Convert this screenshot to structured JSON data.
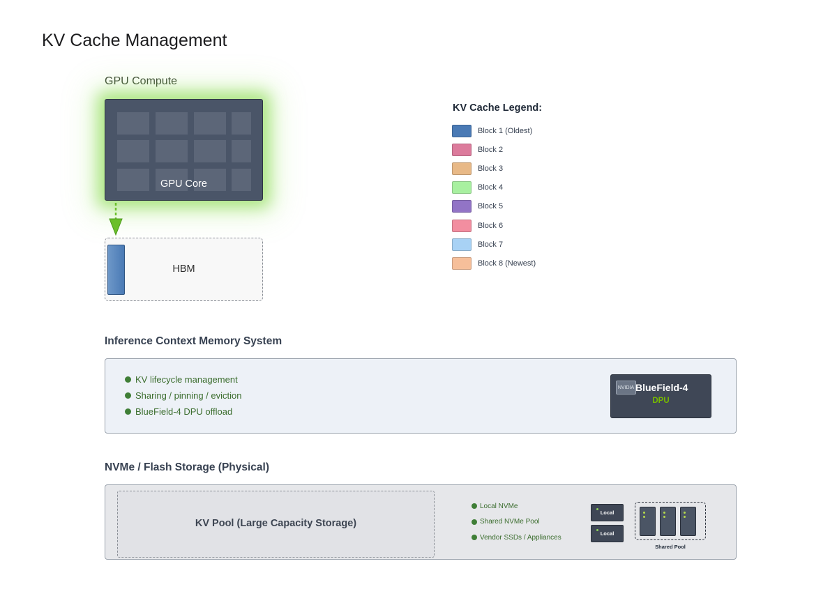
{
  "page": {
    "title": "KV Cache Management"
  },
  "gpu": {
    "section_label": "GPU Compute",
    "core_label": "GPU Core",
    "glow_color": "#76b900",
    "memory_label": "HBM",
    "resident_blocks": [
      "Block 1 (Oldest)"
    ]
  },
  "legend": {
    "title": "KV Cache Legend:",
    "items": [
      {
        "label": "Block 1 (Oldest)",
        "color": "#4a7ab5"
      },
      {
        "label": "Block 2",
        "color": "#dc7b9c"
      },
      {
        "label": "Block 3",
        "color": "#e8b987"
      },
      {
        "label": "Block 4",
        "color": "#a8f0a0"
      },
      {
        "label": "Block 5",
        "color": "#9274c6"
      },
      {
        "label": "Block 6",
        "color": "#f28ea0"
      },
      {
        "label": "Block 7",
        "color": "#a8d2f5"
      },
      {
        "label": "Block 8 (Newest)",
        "color": "#f6bf9a"
      }
    ]
  },
  "icms": {
    "label": "Inference Context Memory System",
    "bullets": [
      "KV lifecycle management",
      "Sharing / pinning / eviction",
      "BlueField-4 DPU offload"
    ],
    "dpu": {
      "badge": "NVIDIA",
      "name": "BlueField-4",
      "type": "DPU"
    }
  },
  "nvme": {
    "label": "NVMe / Flash Storage (Physical)",
    "pool_label": "KV Pool (Large Capacity Storage)",
    "bullets": [
      "Local NVMe",
      "Shared NVMe Pool",
      "Vendor SSDs / Appliances"
    ],
    "local_drives": [
      "Local",
      "Local"
    ],
    "shared_pool_label": "Shared Pool",
    "shared_drive_count": 3
  }
}
